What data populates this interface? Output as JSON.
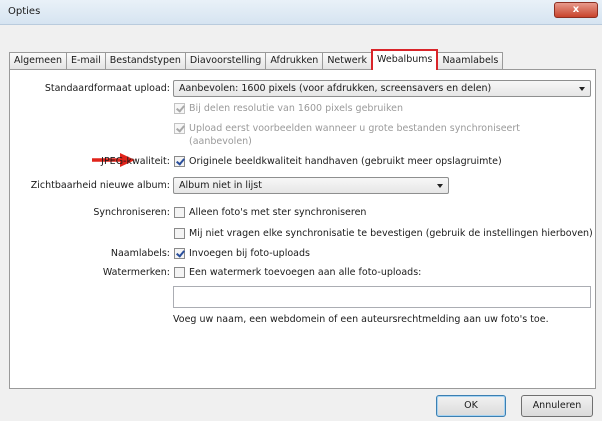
{
  "window": {
    "title": "Opties",
    "close_glyph": "x"
  },
  "tabs": [
    {
      "label": "Algemeen"
    },
    {
      "label": "E-mail"
    },
    {
      "label": "Bestandstypen"
    },
    {
      "label": "Diavoorstelling"
    },
    {
      "label": "Afdrukken"
    },
    {
      "label": "Netwerk"
    },
    {
      "label": "Webalbums"
    },
    {
      "label": "Naamlabels"
    }
  ],
  "active_tab": "Webalbums",
  "form": {
    "upload_size": {
      "label": "Standaardformaat upload:",
      "value": "Aanbevolen: 1600 pixels (voor afdrukken, screensavers en delen)"
    },
    "share_resolution": {
      "label": "Bij delen resolutie van 1600 pixels gebruiken",
      "checked": true,
      "disabled": true
    },
    "upload_preview_line1": "Upload eerst voorbeelden wanneer u grote bestanden synchroniseert",
    "upload_preview_line2": "(aanbevolen)",
    "upload_preview": {
      "checked": true,
      "disabled": true
    },
    "jpeg_quality": {
      "label": "JPEG-kwaliteit:",
      "option": "Originele beeldkwaliteit handhaven (gebruikt meer opslagruimte)",
      "checked": true
    },
    "visibility": {
      "label": "Zichtbaarheid nieuwe album:",
      "value": "Album niet in lijst"
    },
    "sync": {
      "label": "Synchroniseren:",
      "starred_only": "Alleen foto's met ster synchroniseren",
      "starred_checked": false,
      "no_confirm": "Mij niet vragen elke synchronisatie te bevestigen (gebruik de instellingen hierboven)",
      "no_confirm_checked": false
    },
    "name_tags": {
      "label": "Naamlabels:",
      "option": "Invoegen bij foto-uploads",
      "checked": true
    },
    "watermark": {
      "label": "Watermerken:",
      "option": "Een watermerk toevoegen aan alle foto-uploads:",
      "checked": false,
      "input_value": "",
      "hint": "Voeg uw naam, een webdomein of een auteursrechtmelding aan uw foto's toe."
    }
  },
  "buttons": {
    "ok": "OK",
    "cancel": "Annuleren"
  },
  "colors": {
    "highlight": "#d9252a",
    "arrow": "#e0241b"
  }
}
